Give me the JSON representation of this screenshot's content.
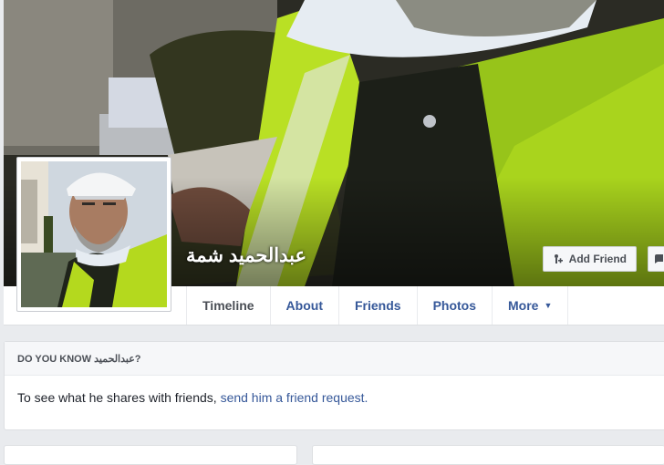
{
  "profile": {
    "name": "عبدالحميد شمة"
  },
  "actions": {
    "add_friend_label": "Add Friend",
    "add_friend_icon": "add-friend-icon",
    "more_partial_icon": "message-icon"
  },
  "tabs": [
    {
      "label": "Timeline"
    },
    {
      "label": "About"
    },
    {
      "label": "Friends"
    },
    {
      "label": "Photos"
    },
    {
      "label": "More"
    }
  ],
  "card": {
    "heading": "DO YOU KNOW عبدالحميد?",
    "text": "To see what he shares with friends, ",
    "link": "send him a friend request."
  },
  "colors": {
    "link": "#365899",
    "vest": "#b4d91e",
    "page_bg": "#e9ebee"
  }
}
